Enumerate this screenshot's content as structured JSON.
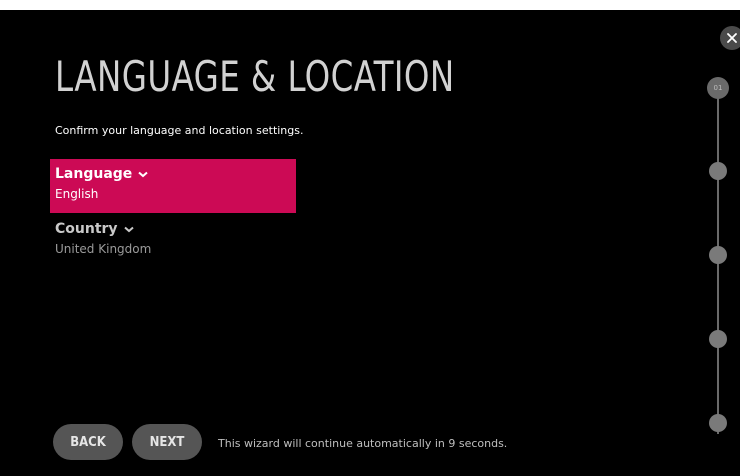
{
  "header": {
    "title": "LANGUAGE & LOCATION",
    "subtitle": "Confirm your language and location settings."
  },
  "settings": [
    {
      "label": "Language",
      "value": "English",
      "focused": true
    },
    {
      "label": "Country",
      "value": "United Kingdom",
      "focused": false
    }
  ],
  "progress": {
    "current_step_label": "01",
    "total_steps": 5,
    "current_step": 1
  },
  "footer": {
    "back_label": "BACK",
    "next_label": "NEXT",
    "auto_message": "This wizard will continue automatically in 9 seconds."
  },
  "icons": {
    "close": "close-icon",
    "dropdown": "chevron-down-icon"
  },
  "colors": {
    "background": "#000000",
    "focus_accent": "#cc0a55",
    "button": "#555555"
  }
}
